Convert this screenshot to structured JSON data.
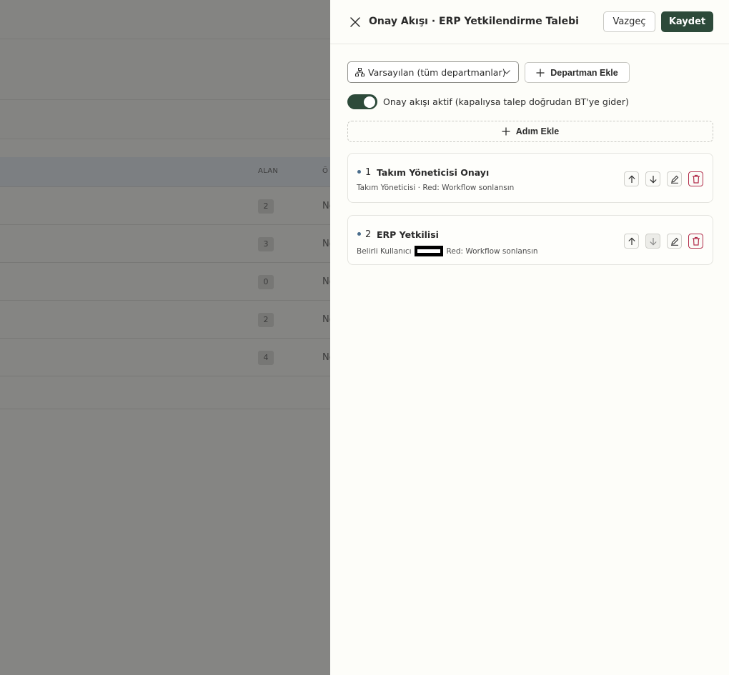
{
  "background": {
    "table_headers": [
      "ALAN",
      "Ö"
    ],
    "rows": [
      {
        "count": "2",
        "cut_text": "Ne"
      },
      {
        "count": "3",
        "cut_text": "Ne"
      },
      {
        "count": "0",
        "cut_text": "Ne"
      },
      {
        "count": "2",
        "cut_text": "Ne"
      },
      {
        "count": "4",
        "cut_text": "Ne"
      }
    ]
  },
  "drawer": {
    "title": "Onay Akışı · ERP Yetkilendirme Talebi",
    "cancel_label": "Vazgeç",
    "save_label": "Kaydet",
    "department_select": {
      "selected": "Varsayılan (tüm departmanlar)",
      "icon": "org-chart-icon"
    },
    "add_department_label": "Departman Ekle",
    "toggle": {
      "on": true,
      "label": "Onay akışı aktif (kapalıysa talep doğrudan BT'ye gider)"
    },
    "add_step_label": "Adım Ekle",
    "steps": [
      {
        "number": "1",
        "title": "Takım Yöneticisi Onayı",
        "subtitle": "Takım Yöneticisi · Red: Workflow sonlansın"
      },
      {
        "number": "2",
        "title": "ERP Yetkilisi",
        "subtitle_prefix": "Belirli Kullanıcı",
        "subtitle_suffix": "Red: Workflow sonlansın"
      }
    ]
  },
  "colors": {
    "accent": "#2d4a3a",
    "danger": "#b22d4b",
    "step_dot": "#4a6d8c",
    "overlay": "#858583"
  }
}
